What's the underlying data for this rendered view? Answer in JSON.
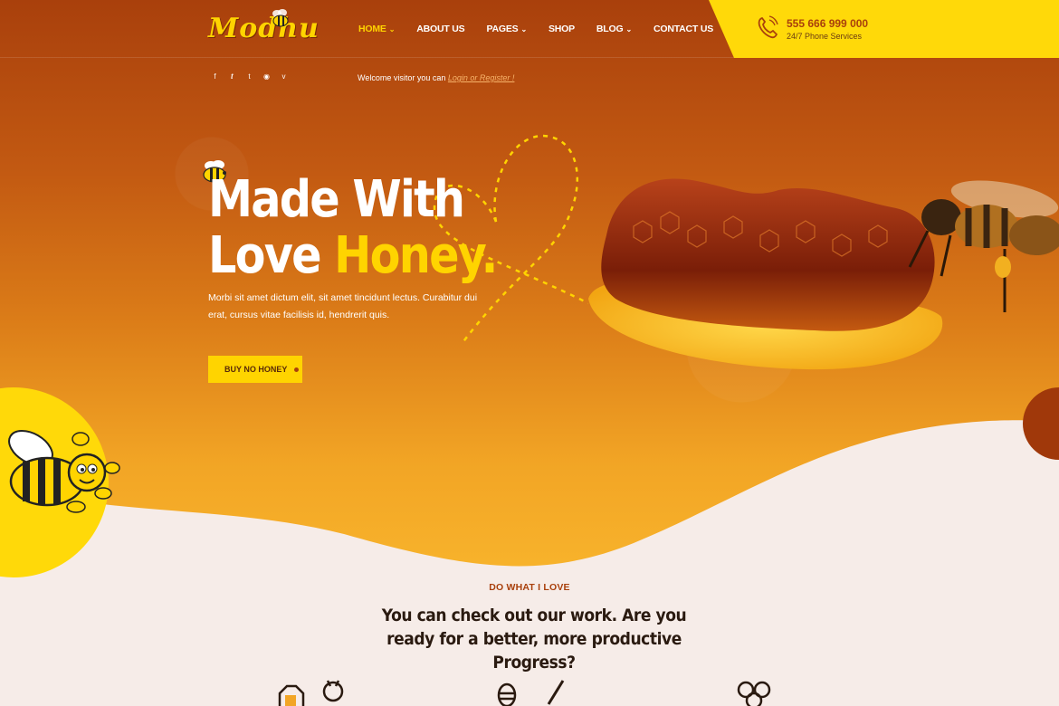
{
  "header": {
    "logo": "Modhu",
    "nav": [
      {
        "label": "HOME",
        "dropdown": true,
        "active": true
      },
      {
        "label": "ABOUT US",
        "dropdown": false,
        "active": false
      },
      {
        "label": "PAGES",
        "dropdown": true,
        "active": false
      },
      {
        "label": "SHOP",
        "dropdown": false,
        "active": false
      },
      {
        "label": "BLOG",
        "dropdown": true,
        "active": false
      },
      {
        "label": "CONTACT US",
        "dropdown": false,
        "active": false
      }
    ],
    "phone": {
      "number": "555 666 999 000",
      "subtitle": "24/7 Phone Services"
    }
  },
  "topbar": {
    "socials": [
      "facebook-icon",
      "twitter-icon",
      "tumblr-icon",
      "pinterest-icon",
      "vimeo-icon"
    ],
    "welcome_text": "Welcome visitor you can",
    "login_link": "Login or Register !"
  },
  "hero": {
    "title_line1": "Made With",
    "title_line2_plain": "Love ",
    "title_line2_highlight": "Honey.",
    "description": "Morbi sit amet dictum elit, sit amet tincidunt lectus. Curabitur dui erat, cursus vitae facilisis id, hendrerit quis.",
    "button_label": "BUY NO HONEY"
  },
  "section": {
    "tag": "DO WHAT I LOVE",
    "title": "You can check out our work. Are you ready for a better, more productive Progress?"
  },
  "colors": {
    "primary_dark": "#a9400c",
    "accent_yellow": "#ffd400",
    "section_bg": "#f6ece8"
  }
}
